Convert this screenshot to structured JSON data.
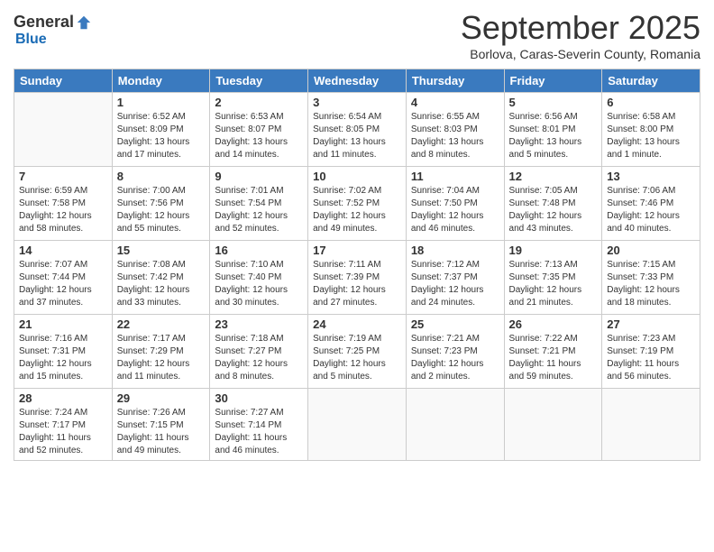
{
  "logo": {
    "general": "General",
    "blue": "Blue"
  },
  "title": "September 2025",
  "location": "Borlova, Caras-Severin County, Romania",
  "days_of_week": [
    "Sunday",
    "Monday",
    "Tuesday",
    "Wednesday",
    "Thursday",
    "Friday",
    "Saturday"
  ],
  "weeks": [
    [
      {
        "day": "",
        "info": ""
      },
      {
        "day": "1",
        "info": "Sunrise: 6:52 AM\nSunset: 8:09 PM\nDaylight: 13 hours\nand 17 minutes."
      },
      {
        "day": "2",
        "info": "Sunrise: 6:53 AM\nSunset: 8:07 PM\nDaylight: 13 hours\nand 14 minutes."
      },
      {
        "day": "3",
        "info": "Sunrise: 6:54 AM\nSunset: 8:05 PM\nDaylight: 13 hours\nand 11 minutes."
      },
      {
        "day": "4",
        "info": "Sunrise: 6:55 AM\nSunset: 8:03 PM\nDaylight: 13 hours\nand 8 minutes."
      },
      {
        "day": "5",
        "info": "Sunrise: 6:56 AM\nSunset: 8:01 PM\nDaylight: 13 hours\nand 5 minutes."
      },
      {
        "day": "6",
        "info": "Sunrise: 6:58 AM\nSunset: 8:00 PM\nDaylight: 13 hours\nand 1 minute."
      }
    ],
    [
      {
        "day": "7",
        "info": "Sunrise: 6:59 AM\nSunset: 7:58 PM\nDaylight: 12 hours\nand 58 minutes."
      },
      {
        "day": "8",
        "info": "Sunrise: 7:00 AM\nSunset: 7:56 PM\nDaylight: 12 hours\nand 55 minutes."
      },
      {
        "day": "9",
        "info": "Sunrise: 7:01 AM\nSunset: 7:54 PM\nDaylight: 12 hours\nand 52 minutes."
      },
      {
        "day": "10",
        "info": "Sunrise: 7:02 AM\nSunset: 7:52 PM\nDaylight: 12 hours\nand 49 minutes."
      },
      {
        "day": "11",
        "info": "Sunrise: 7:04 AM\nSunset: 7:50 PM\nDaylight: 12 hours\nand 46 minutes."
      },
      {
        "day": "12",
        "info": "Sunrise: 7:05 AM\nSunset: 7:48 PM\nDaylight: 12 hours\nand 43 minutes."
      },
      {
        "day": "13",
        "info": "Sunrise: 7:06 AM\nSunset: 7:46 PM\nDaylight: 12 hours\nand 40 minutes."
      }
    ],
    [
      {
        "day": "14",
        "info": "Sunrise: 7:07 AM\nSunset: 7:44 PM\nDaylight: 12 hours\nand 37 minutes."
      },
      {
        "day": "15",
        "info": "Sunrise: 7:08 AM\nSunset: 7:42 PM\nDaylight: 12 hours\nand 33 minutes."
      },
      {
        "day": "16",
        "info": "Sunrise: 7:10 AM\nSunset: 7:40 PM\nDaylight: 12 hours\nand 30 minutes."
      },
      {
        "day": "17",
        "info": "Sunrise: 7:11 AM\nSunset: 7:39 PM\nDaylight: 12 hours\nand 27 minutes."
      },
      {
        "day": "18",
        "info": "Sunrise: 7:12 AM\nSunset: 7:37 PM\nDaylight: 12 hours\nand 24 minutes."
      },
      {
        "day": "19",
        "info": "Sunrise: 7:13 AM\nSunset: 7:35 PM\nDaylight: 12 hours\nand 21 minutes."
      },
      {
        "day": "20",
        "info": "Sunrise: 7:15 AM\nSunset: 7:33 PM\nDaylight: 12 hours\nand 18 minutes."
      }
    ],
    [
      {
        "day": "21",
        "info": "Sunrise: 7:16 AM\nSunset: 7:31 PM\nDaylight: 12 hours\nand 15 minutes."
      },
      {
        "day": "22",
        "info": "Sunrise: 7:17 AM\nSunset: 7:29 PM\nDaylight: 12 hours\nand 11 minutes."
      },
      {
        "day": "23",
        "info": "Sunrise: 7:18 AM\nSunset: 7:27 PM\nDaylight: 12 hours\nand 8 minutes."
      },
      {
        "day": "24",
        "info": "Sunrise: 7:19 AM\nSunset: 7:25 PM\nDaylight: 12 hours\nand 5 minutes."
      },
      {
        "day": "25",
        "info": "Sunrise: 7:21 AM\nSunset: 7:23 PM\nDaylight: 12 hours\nand 2 minutes."
      },
      {
        "day": "26",
        "info": "Sunrise: 7:22 AM\nSunset: 7:21 PM\nDaylight: 11 hours\nand 59 minutes."
      },
      {
        "day": "27",
        "info": "Sunrise: 7:23 AM\nSunset: 7:19 PM\nDaylight: 11 hours\nand 56 minutes."
      }
    ],
    [
      {
        "day": "28",
        "info": "Sunrise: 7:24 AM\nSunset: 7:17 PM\nDaylight: 11 hours\nand 52 minutes."
      },
      {
        "day": "29",
        "info": "Sunrise: 7:26 AM\nSunset: 7:15 PM\nDaylight: 11 hours\nand 49 minutes."
      },
      {
        "day": "30",
        "info": "Sunrise: 7:27 AM\nSunset: 7:14 PM\nDaylight: 11 hours\nand 46 minutes."
      },
      {
        "day": "",
        "info": ""
      },
      {
        "day": "",
        "info": ""
      },
      {
        "day": "",
        "info": ""
      },
      {
        "day": "",
        "info": ""
      }
    ]
  ]
}
